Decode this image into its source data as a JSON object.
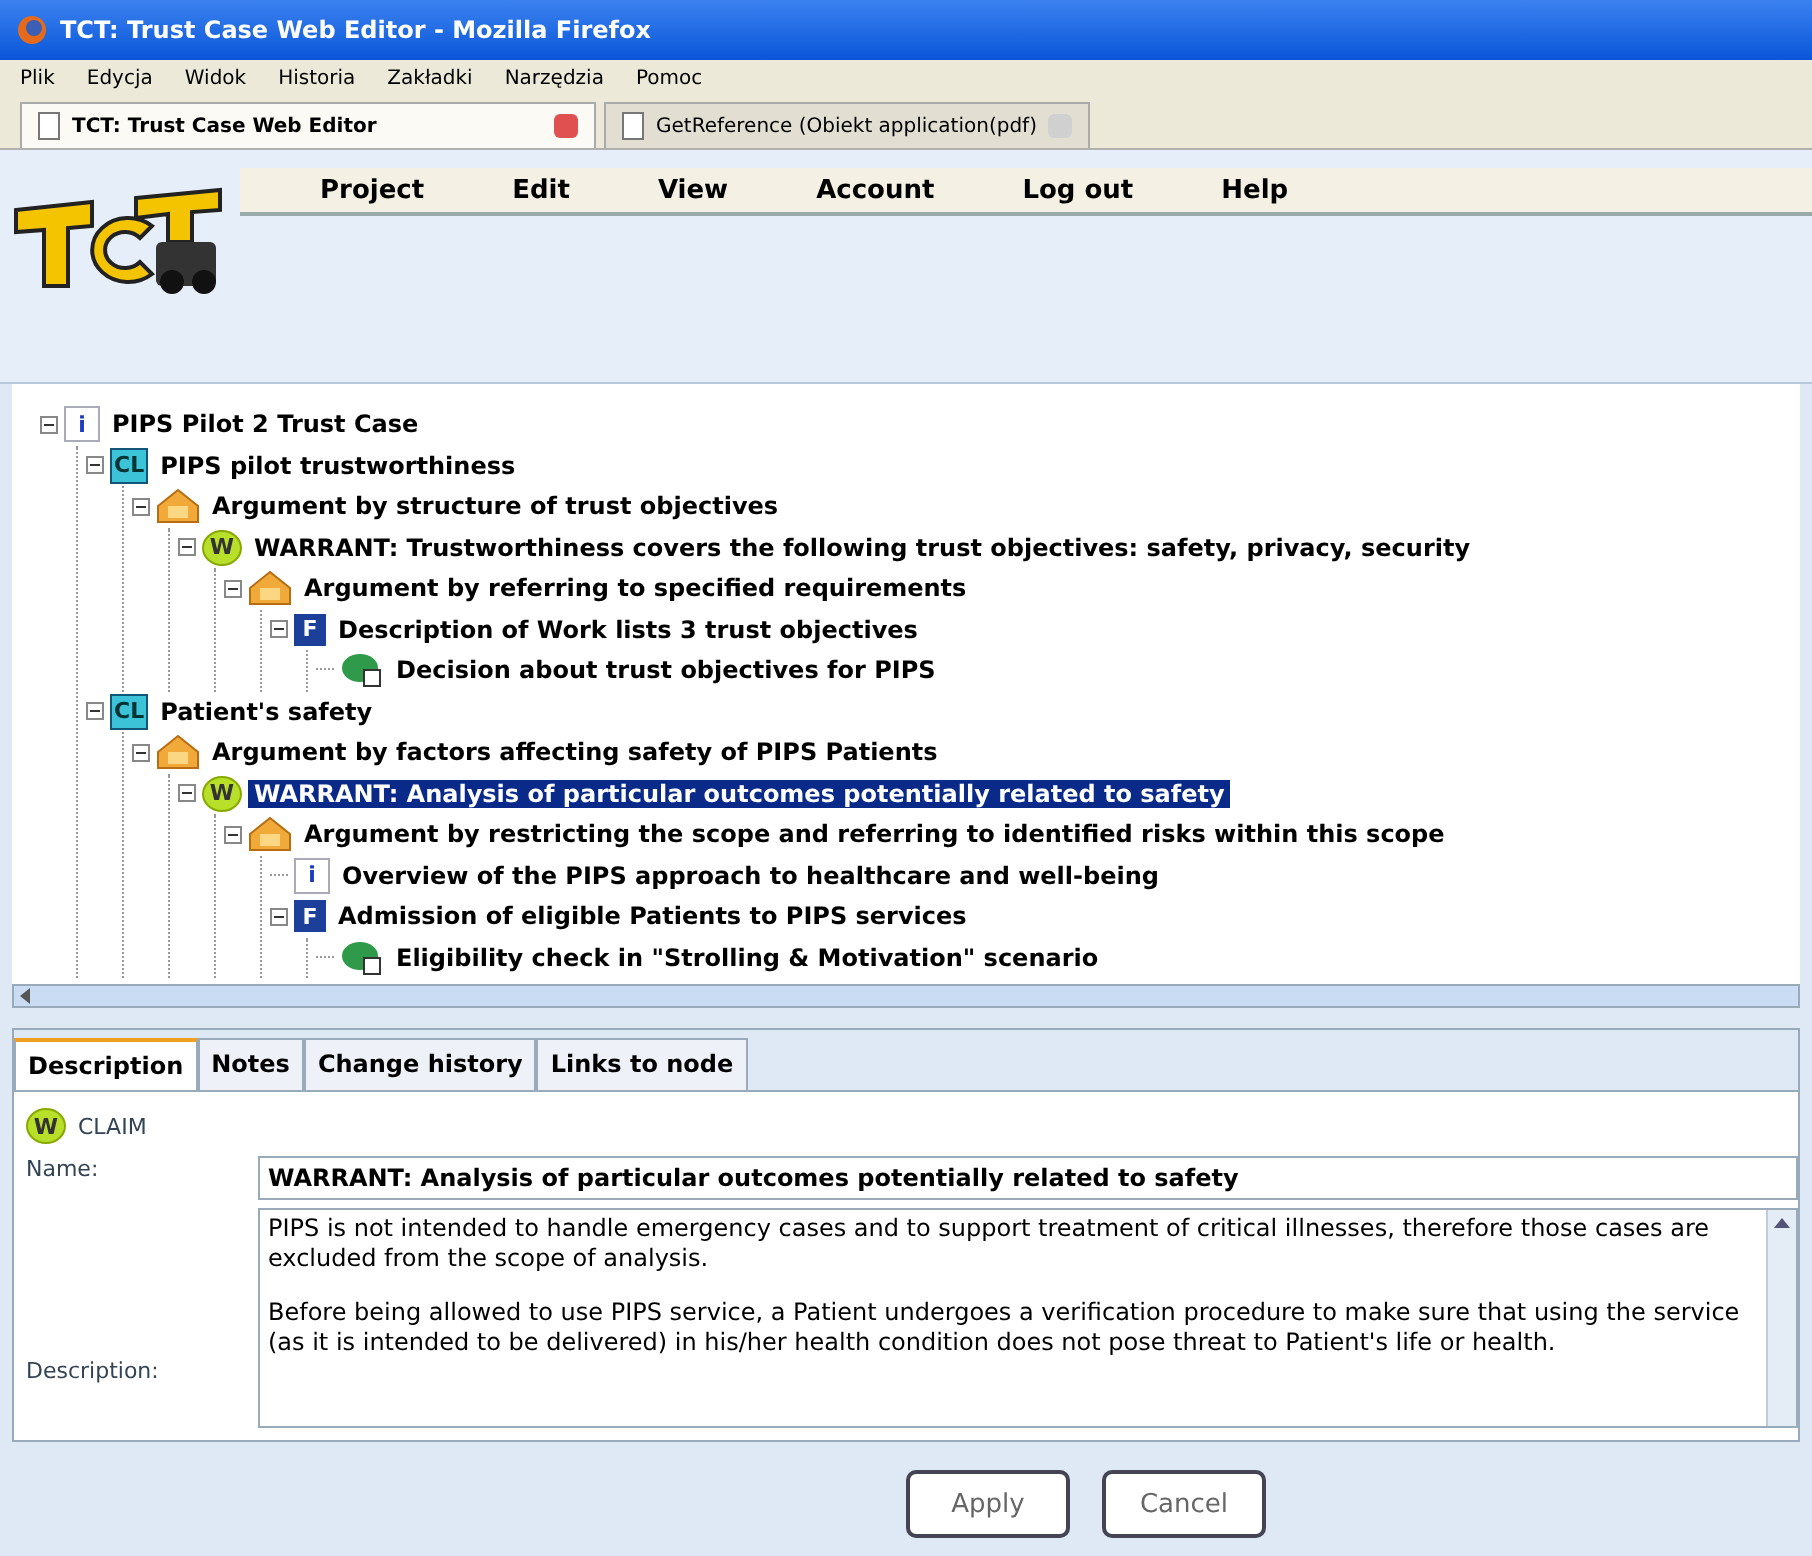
{
  "window": {
    "title": "TCT: Trust Case Web Editor - Mozilla Firefox"
  },
  "menu_bar": [
    "Plik",
    "Edycja",
    "Widok",
    "Historia",
    "Zakładki",
    "Narzędzia",
    "Pomoc"
  ],
  "browser_tabs": [
    {
      "title": "TCT: Trust Case Web Editor",
      "selected": true
    },
    {
      "title": "GetReference (Obiekt application(pdf)",
      "selected": false
    }
  ],
  "app_menu": [
    "Project",
    "Edit",
    "View",
    "Account",
    "Log out",
    "Help"
  ],
  "tree": [
    {
      "kind": "info",
      "badge": "i",
      "label": "PIPS Pilot 2 Trust Case",
      "expanded": true,
      "selected": false,
      "children": [
        {
          "kind": "claim",
          "badge": "CL",
          "label": "PIPS pilot trustworthiness",
          "expanded": true,
          "selected": false,
          "children": [
            {
              "kind": "argument",
              "label": "Argument by structure of trust objectives",
              "expanded": true,
              "selected": false,
              "children": [
                {
                  "kind": "warrant",
                  "badge": "W",
                  "label": "WARRANT: Trustworthiness covers the following trust objectives: safety, privacy, security",
                  "expanded": true,
                  "selected": false,
                  "children": [
                    {
                      "kind": "argument",
                      "label": "Argument by referring to specified requirements",
                      "expanded": true,
                      "selected": false,
                      "children": [
                        {
                          "kind": "fact",
                          "badge": "F",
                          "label": "Description of Work lists 3 trust objectives",
                          "expanded": true,
                          "selected": false,
                          "children": [
                            {
                              "kind": "decision",
                              "label": "Decision about trust objectives for PIPS",
                              "expanded": false,
                              "selected": false
                            }
                          ]
                        }
                      ]
                    }
                  ]
                }
              ]
            }
          ]
        },
        {
          "kind": "claim",
          "badge": "CL",
          "label": "Patient's safety",
          "expanded": true,
          "selected": false,
          "children": [
            {
              "kind": "argument",
              "label": "Argument by factors affecting safety of PIPS Patients",
              "expanded": true,
              "selected": false,
              "children": [
                {
                  "kind": "warrant",
                  "badge": "W",
                  "label": "WARRANT: Analysis of particular outcomes potentially related to safety",
                  "expanded": true,
                  "selected": true,
                  "children": [
                    {
                      "kind": "argument",
                      "label": "Argument by restricting the scope and referring to identified risks within this scope",
                      "expanded": true,
                      "selected": false,
                      "children": [
                        {
                          "kind": "info",
                          "badge": "i",
                          "label": "Overview of the PIPS approach to healthcare and well-being",
                          "expanded": false,
                          "selected": false
                        },
                        {
                          "kind": "fact",
                          "badge": "F",
                          "label": "Admission of eligible Patients to PIPS services",
                          "expanded": true,
                          "selected": false,
                          "children": [
                            {
                              "kind": "decision",
                              "label": "Eligibility check in \"Strolling & Motivation\" scenario",
                              "expanded": false,
                              "selected": false
                            }
                          ]
                        }
                      ]
                    }
                  ]
                }
              ]
            }
          ]
        }
      ]
    }
  ],
  "detail_tabs": [
    {
      "label": "Description",
      "selected": true
    },
    {
      "label": "Notes",
      "selected": false
    },
    {
      "label": "Change history",
      "selected": false
    },
    {
      "label": "Links to node",
      "selected": false
    }
  ],
  "node_type": {
    "badge": "W",
    "label": "CLAIM"
  },
  "name_field": {
    "label": "Name:",
    "value": "WARRANT: Analysis of particular outcomes potentially related to safety"
  },
  "description_field": {
    "label": "Description:",
    "paragraphs": [
      "PIPS is not intended to handle emergency cases and to support treatment of critical illnesses, therefore those cases are excluded from the scope of analysis.",
      "Before being allowed to use  PIPS service, a Patient undergoes a verification procedure to make sure that using the service (as it is intended to be delivered) in his/her health condition does not pose threat to Patient's life or health."
    ]
  },
  "buttons": [
    "Apply",
    "Cancel"
  ]
}
